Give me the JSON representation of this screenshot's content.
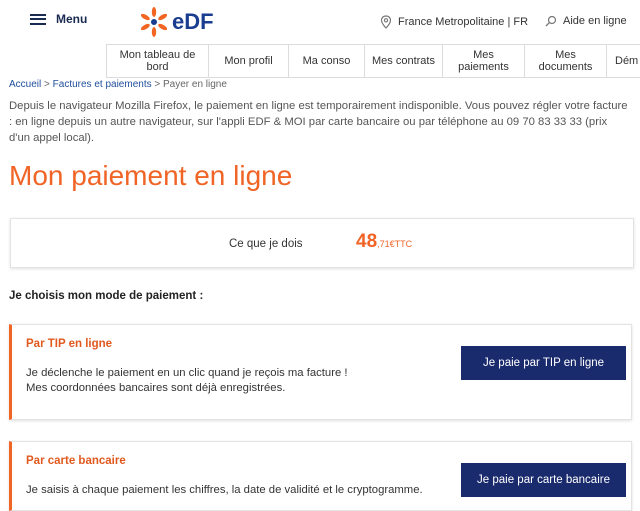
{
  "header": {
    "menu_label": "Menu",
    "logo_text": "eDF",
    "region": "France Metropolitaine | FR",
    "help": "Aide en ligne"
  },
  "subnav": {
    "items": [
      {
        "label": "Mon tableau de bord"
      },
      {
        "label": "Mon profil"
      },
      {
        "label": "Ma conso"
      },
      {
        "label": "Mes contrats"
      },
      {
        "label": "Mes paiements"
      },
      {
        "label": "Mes documents"
      },
      {
        "label": "Dém"
      }
    ]
  },
  "breadcrumb": {
    "home": "Accueil",
    "sep1": " > ",
    "section": "Factures et paiements",
    "sep2": " > ",
    "current": "Payer en ligne"
  },
  "notice": "Depuis le navigateur Mozilla Firefox, le paiement en ligne est temporairement indisponible. Vous pouvez régler votre facture : en ligne depuis un autre navigateur, sur l'appli EDF & MOI par carte bancaire ou par téléphone au 09 70 83 33 33 (prix d'un appel local).",
  "page_title": "Mon paiement en ligne",
  "amount": {
    "label": "Ce que je dois",
    "integer": "48",
    "decimal": ",71",
    "unit": "€TTC"
  },
  "choose_label": "Je choisis mon mode de paiement :",
  "payment_options": [
    {
      "title": "Par TIP en ligne",
      "description_line1": "Je déclenche le paiement en un clic quand je reçois ma facture !",
      "description_line2": "Mes coordonnées bancaires sont déjà enregistrées.",
      "button": "Je paie par TIP en ligne"
    },
    {
      "title": "Par carte bancaire",
      "description_line1": "Je saisis à chaque paiement les chiffres, la date de validité et le cryptogramme.",
      "button": "Je paie par carte bancaire"
    }
  ],
  "colors": {
    "accent": "#f06426",
    "brand_blue": "#1a3d8f",
    "button_bg": "#1a2b6d"
  }
}
